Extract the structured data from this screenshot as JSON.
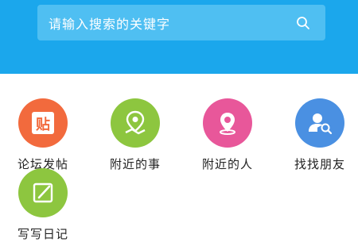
{
  "search": {
    "placeholder": "请输入搜索的关键字"
  },
  "menu": [
    {
      "label": "论坛发帖",
      "color": "#f26a3d",
      "icon": "post-icon",
      "glyph": "贴"
    },
    {
      "label": "附近的事",
      "color": "#8dc63f",
      "icon": "map-pin-icon"
    },
    {
      "label": "附近的人",
      "color": "#e8579a",
      "icon": "location-pin-icon"
    },
    {
      "label": "找找朋友",
      "color": "#4a90e2",
      "icon": "find-friend-icon"
    },
    {
      "label": "写写日记",
      "color": "#8dc63f",
      "icon": "diary-icon"
    }
  ],
  "colors": {
    "header": "#1ba7ec",
    "search_bg": "#4fbff2"
  }
}
